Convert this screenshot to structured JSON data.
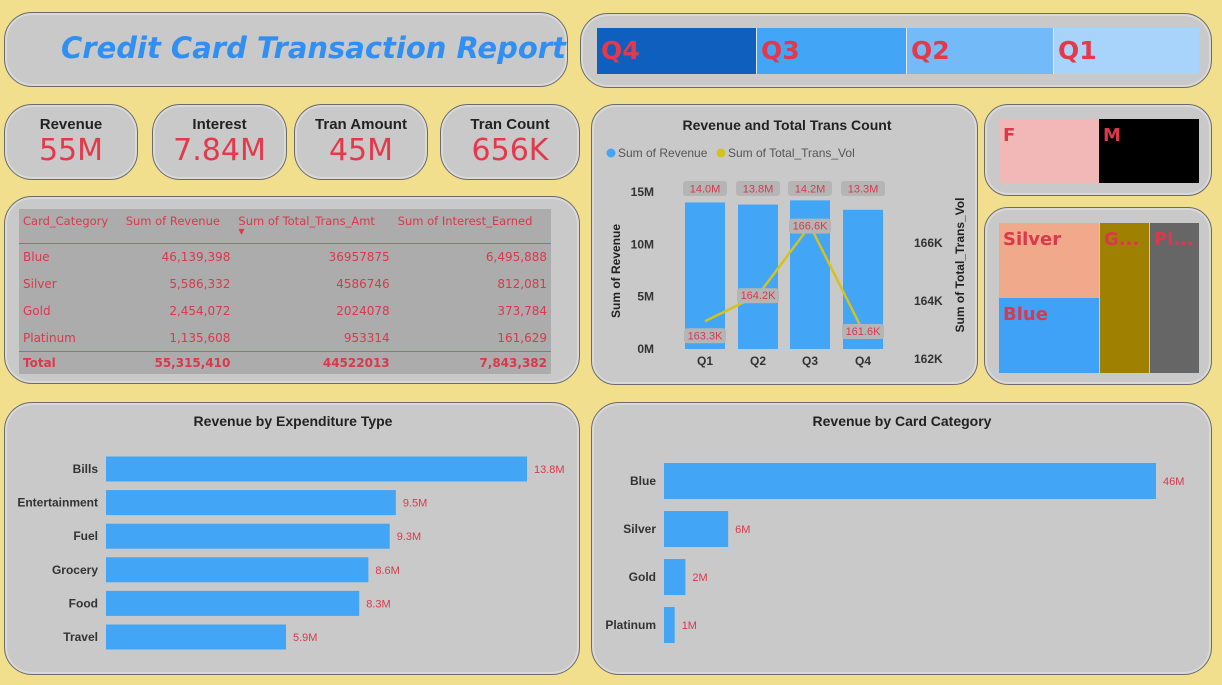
{
  "title": "Credit Card Transaction Report",
  "quarters": [
    {
      "label": "Q4",
      "color": "#0f5fbf"
    },
    {
      "label": "Q3",
      "color": "#42a5f5"
    },
    {
      "label": "Q2",
      "color": "#73baf9"
    },
    {
      "label": "Q1",
      "color": "#a8d4fb"
    }
  ],
  "kpis": [
    {
      "label": "Revenue",
      "value": "55M"
    },
    {
      "label": "Interest",
      "value": "7.84M"
    },
    {
      "label": "Tran Amount",
      "value": "45M"
    },
    {
      "label": "Tran Count",
      "value": "656K"
    }
  ],
  "table": {
    "headers": [
      "Card_Category",
      "Sum of Revenue",
      "Sum of Total_Trans_Amt",
      "Sum of Interest_Earned"
    ],
    "rows": [
      [
        "Blue",
        "46,139,398",
        "36957875",
        "6,495,888"
      ],
      [
        "Silver",
        "5,586,332",
        "4586746",
        "812,081"
      ],
      [
        "Gold",
        "2,454,072",
        "2024078",
        "373,784"
      ],
      [
        "Platinum",
        "1,135,608",
        "953314",
        "161,629"
      ]
    ],
    "total": [
      "Total",
      "55,315,410",
      "44522013",
      "7,843,382"
    ]
  },
  "gender_tiles": [
    {
      "label": "F",
      "color": "#f2b8b8"
    },
    {
      "label": "M",
      "color": "#000000"
    }
  ],
  "category_tiles": [
    {
      "label": "Silver",
      "color": "#f0a98a"
    },
    {
      "label": "Blue",
      "color": "#3fa2f7"
    },
    {
      "label": "G...",
      "color": "#a08000"
    },
    {
      "label": "Pl...",
      "color": "#666666"
    }
  ],
  "chart_data": [
    {
      "type": "bar+line",
      "title": "Revenue and Total Trans Count",
      "legend": [
        "Sum of Revenue",
        "Sum of Total_Trans_Vol"
      ],
      "legend_placement": "top-left",
      "categories": [
        "Q1",
        "Q2",
        "Q3",
        "Q4"
      ],
      "series": [
        {
          "name": "Sum of Revenue",
          "kind": "bar",
          "axis": "left",
          "values": [
            14.0,
            13.8,
            14.2,
            13.3
          ],
          "labels": [
            "14.0M",
            "13.8M",
            "14.2M",
            "13.3M"
          ],
          "color": "#42a5f5"
        },
        {
          "name": "Sum of Total_Trans_Vol",
          "kind": "line",
          "axis": "right",
          "values": [
            163.3,
            164.2,
            166.6,
            161.6
          ],
          "labels": [
            "163.3K",
            "164.2K",
            "166.6K",
            "161.6K"
          ],
          "color": "#d4c21e"
        }
      ],
      "ylabel": "Sum of Revenue",
      "y2label": "Sum of Total_Trans_Vol",
      "ylim": [
        0,
        15
      ],
      "yticks": [
        "0M",
        "5M",
        "10M",
        "15M"
      ],
      "y2lim": [
        161.2,
        166.8
      ],
      "y2ticks": [
        "162K",
        "164K",
        "166K"
      ]
    },
    {
      "type": "bar",
      "orientation": "horizontal",
      "title": "Revenue by Expenditure Type",
      "categories": [
        "Bills",
        "Entertainment",
        "Fuel",
        "Grocery",
        "Food",
        "Travel"
      ],
      "values": [
        13.8,
        9.5,
        9.3,
        8.6,
        8.3,
        5.9
      ],
      "labels": [
        "13.8M",
        "9.5M",
        "9.3M",
        "8.6M",
        "8.3M",
        "5.9M"
      ],
      "color": "#42a5f5"
    },
    {
      "type": "bar",
      "orientation": "horizontal",
      "title": "Revenue by Card Category",
      "categories": [
        "Blue",
        "Silver",
        "Gold",
        "Platinum"
      ],
      "values": [
        46,
        6,
        2,
        1
      ],
      "labels": [
        "46M",
        "6M",
        "2M",
        "1M"
      ],
      "color": "#42a5f5"
    }
  ]
}
